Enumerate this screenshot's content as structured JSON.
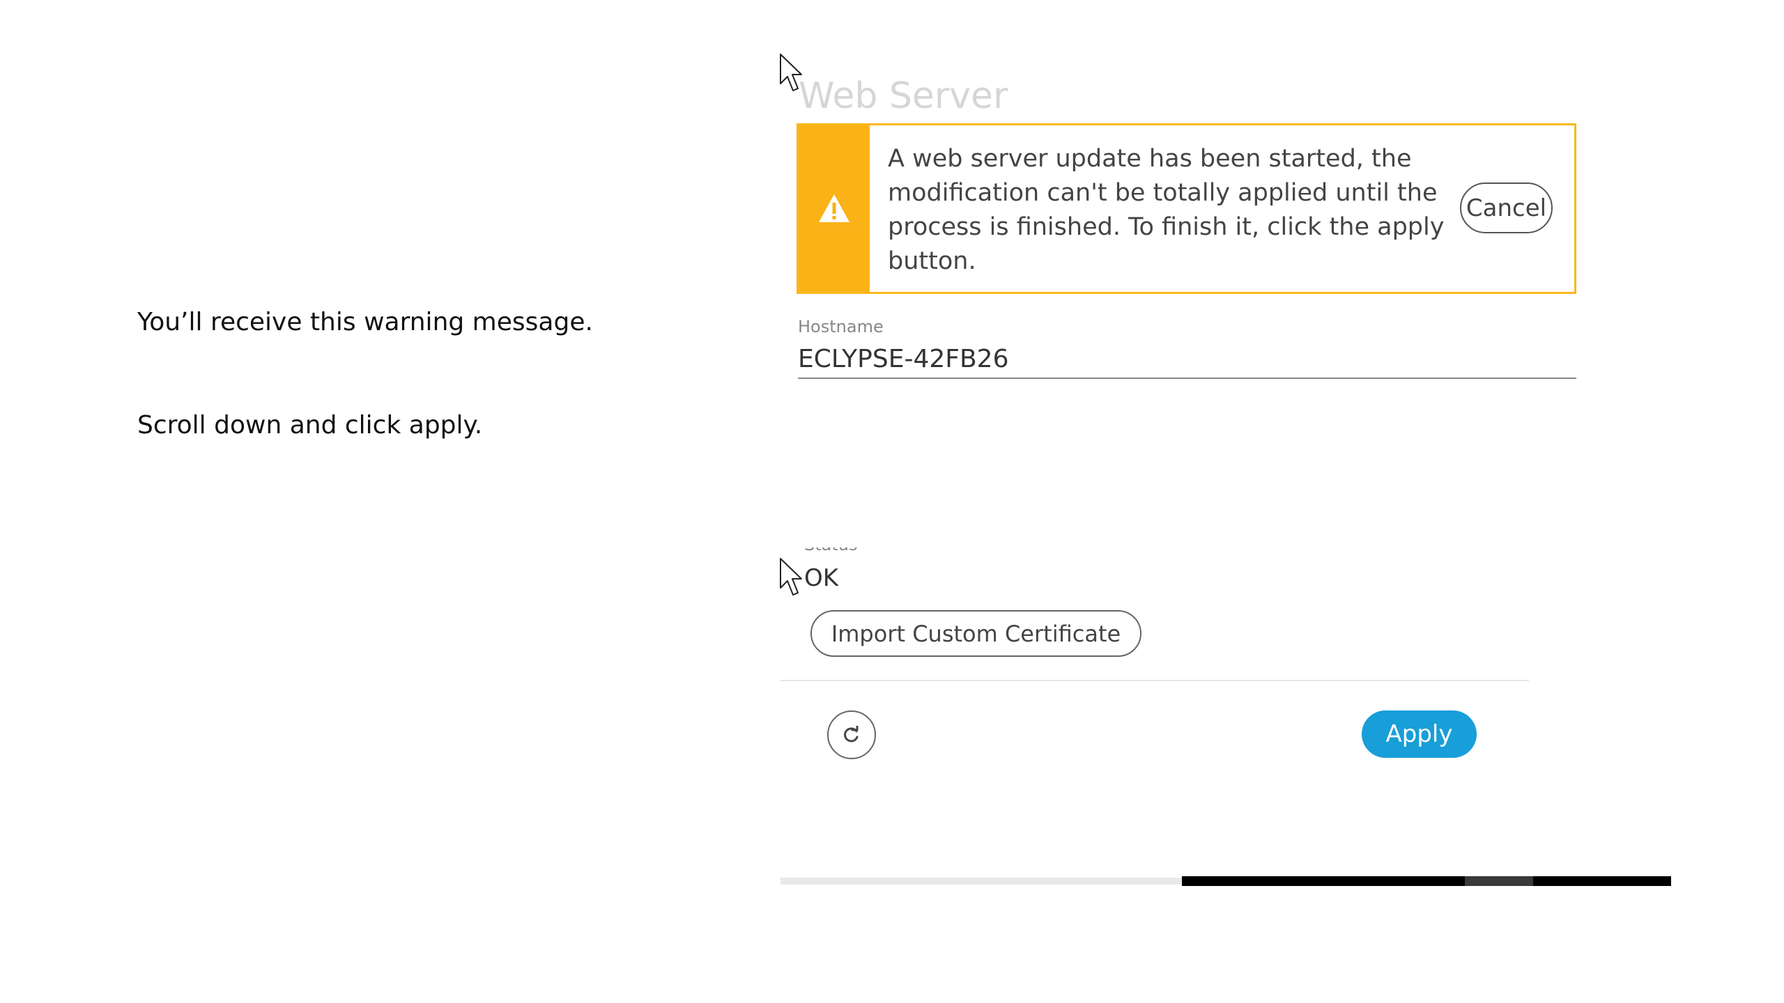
{
  "instructions": {
    "line1": "You’ll receive this warning message.",
    "line2": "Scroll down and click apply."
  },
  "panel": {
    "title": "Web Server",
    "alert": {
      "message": "A web server update has been started, the modification can't be totally applied until the process is finished. To finish it, click the apply button.",
      "cancel_label": "Cancel",
      "icon": "warning-triangle-icon",
      "color": "#fbb217"
    },
    "hostname": {
      "label": "Hostname",
      "value": "ECLYPSE-42FB26"
    },
    "status": {
      "label": "Status",
      "value": "OK"
    },
    "import_certificate_label": "Import Custom Certificate",
    "refresh_icon": "refresh-icon",
    "apply_label": "Apply",
    "apply_color": "#189ed8"
  },
  "cursor_icon": "mouse-pointer-icon"
}
